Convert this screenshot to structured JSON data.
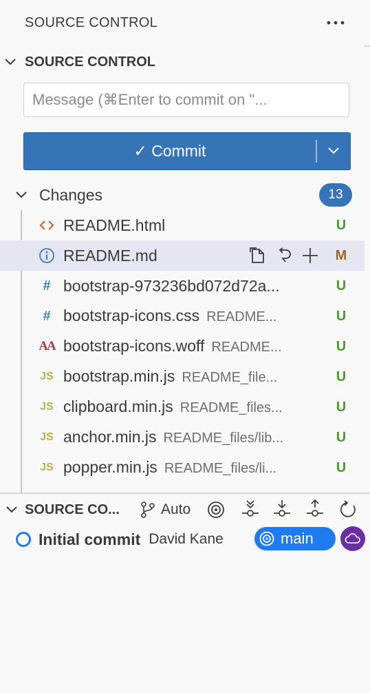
{
  "panel": {
    "title": "SOURCE CONTROL",
    "more_icon": "ellipsis-icon"
  },
  "repo_section": {
    "title": "SOURCE CONTROL"
  },
  "commit_box": {
    "placeholder": "Message (⌘Enter to commit on \"..."
  },
  "commit_button": {
    "label": "✓ Commit"
  },
  "changes": {
    "label": "Changes",
    "count": "13",
    "files": [
      {
        "name": "README.html",
        "dir": "",
        "status": "U",
        "icon": "html-icon"
      },
      {
        "name": "README.md",
        "dir": "",
        "status": "M",
        "icon": "info-icon"
      },
      {
        "name": "bootstrap-973236bd072d72a...",
        "dir": "",
        "status": "U",
        "icon": "css-icon"
      },
      {
        "name": "bootstrap-icons.css",
        "dir": "README...",
        "status": "U",
        "icon": "css-icon"
      },
      {
        "name": "bootstrap-icons.woff",
        "dir": "README...",
        "status": "U",
        "icon": "font-icon"
      },
      {
        "name": "bootstrap.min.js",
        "dir": "README_file...",
        "status": "U",
        "icon": "js-icon"
      },
      {
        "name": "clipboard.min.js",
        "dir": "README_files...",
        "status": "U",
        "icon": "js-icon"
      },
      {
        "name": "anchor.min.js",
        "dir": "README_files/lib...",
        "status": "U",
        "icon": "js-icon"
      },
      {
        "name": "popper.min.js",
        "dir": "README_files/li...",
        "status": "U",
        "icon": "js-icon"
      }
    ]
  },
  "graph": {
    "title": "SOURCE CO...",
    "auto_label": "Auto",
    "commit_message": "Initial commit",
    "author": "David Kane",
    "branch": "main"
  },
  "colors": {
    "accent": "#3474b7",
    "untracked": "#4f9a2f",
    "modified": "#9a6a2c",
    "branch_pill": "#1e7bf0",
    "remote": "#6a2fa3"
  }
}
